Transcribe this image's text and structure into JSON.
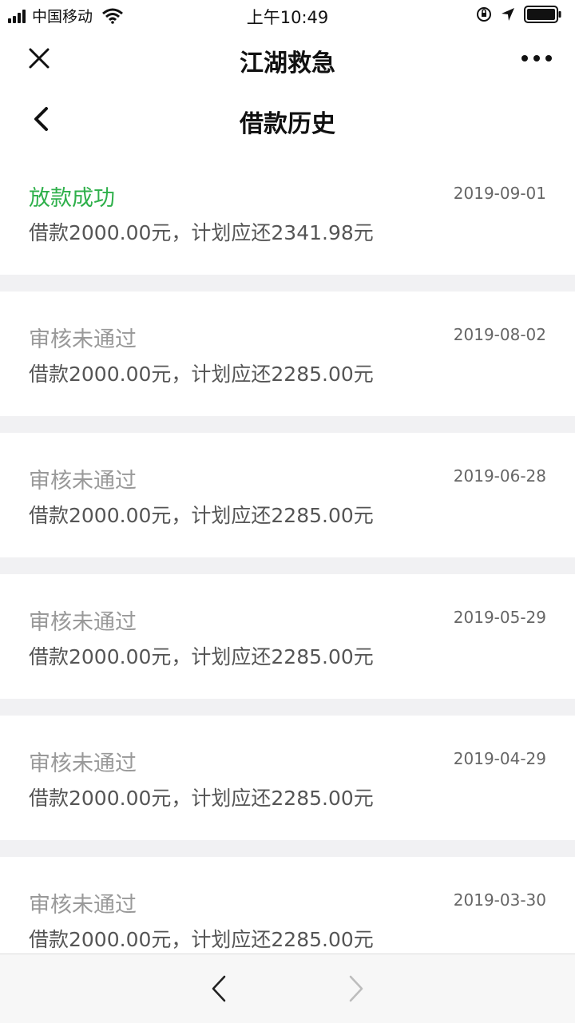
{
  "status_bar": {
    "carrier": "中国移动",
    "time": "上午10:49",
    "icons": [
      "signal-icon",
      "wifi-icon",
      "rotation-lock-icon",
      "location-icon",
      "battery-icon"
    ]
  },
  "app_header": {
    "title": "江湖救急",
    "close_icon": "close-icon",
    "more_icon": "more-icon"
  },
  "page_header": {
    "title": "借款历史",
    "back_icon": "chevron-left-icon"
  },
  "colors": {
    "success": "#2fb04b",
    "rejected": "#999999",
    "list_background": "#f1f1f3"
  },
  "records": [
    {
      "status": "放款成功",
      "date": "2019-09-01",
      "detail": "借款2000.00元，计划应还2341.98元",
      "state": "success"
    },
    {
      "status": "审核未通过",
      "date": "2019-08-02",
      "detail": "借款2000.00元，计划应还2285.00元",
      "state": "rejected"
    },
    {
      "status": "审核未通过",
      "date": "2019-06-28",
      "detail": "借款2000.00元，计划应还2285.00元",
      "state": "rejected"
    },
    {
      "status": "审核未通过",
      "date": "2019-05-29",
      "detail": "借款2000.00元，计划应还2285.00元",
      "state": "rejected"
    },
    {
      "status": "审核未通过",
      "date": "2019-04-29",
      "detail": "借款2000.00元，计划应还2285.00元",
      "state": "rejected"
    },
    {
      "status": "审核未通过",
      "date": "2019-03-30",
      "detail": "借款2000.00元，计划应还2285.00元",
      "state": "rejected"
    }
  ],
  "bottom_nav": {
    "back_icon": "chevron-left-icon",
    "forward_icon": "chevron-right-icon"
  }
}
